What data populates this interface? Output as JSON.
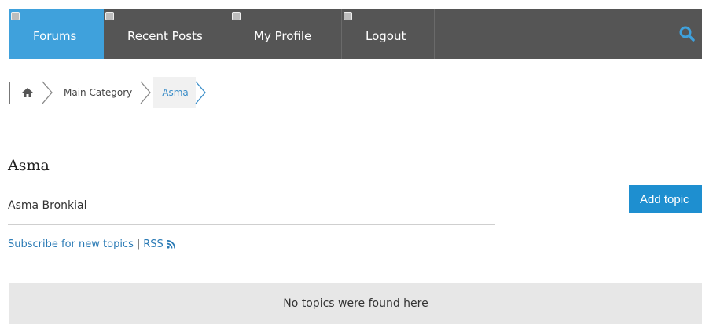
{
  "nav": {
    "items": [
      {
        "label": "Forums",
        "active": true
      },
      {
        "label": "Recent Posts",
        "active": false
      },
      {
        "label": "My Profile",
        "active": false
      },
      {
        "label": "Logout",
        "active": false
      }
    ],
    "search_icon": "search-icon",
    "bg_color": "#555555",
    "active_color": "#3fa1dc"
  },
  "breadcrumb": {
    "home_icon": "home-icon",
    "items": [
      "Main Category",
      "Asma"
    ]
  },
  "page": {
    "title": "Asma",
    "subtitle": "Asma Bronkial",
    "add_topic_label": "Add topic",
    "subscribe_label": "Subscribe for new topics",
    "separator": "|",
    "rss_label": "RSS",
    "empty_message": "No topics were found here",
    "button_color": "#1e8fd0"
  }
}
